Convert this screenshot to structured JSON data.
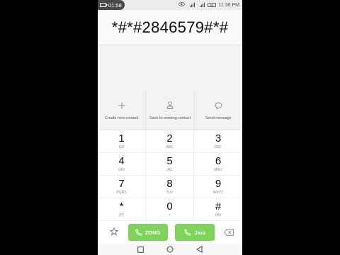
{
  "status_bar": {
    "recording_time": "01:58",
    "clock": "11:36 PM",
    "battery_level": "25",
    "signal_1_label": "4G",
    "signal_2_label": "4G"
  },
  "display": {
    "number": "*#*#2846579#*#"
  },
  "actions": [
    {
      "label": "Create new contact",
      "icon": "plus-icon"
    },
    {
      "label": "Save to existing contact",
      "icon": "person-icon"
    },
    {
      "label": "Send message",
      "icon": "message-icon"
    }
  ],
  "keypad": [
    {
      "digit": "1",
      "letters": "QD"
    },
    {
      "digit": "2",
      "letters": "ABC"
    },
    {
      "digit": "3",
      "letters": "DEF"
    },
    {
      "digit": "4",
      "letters": "GHI"
    },
    {
      "digit": "5",
      "letters": "JKL"
    },
    {
      "digit": "6",
      "letters": "MNO"
    },
    {
      "digit": "7",
      "letters": "PQRS"
    },
    {
      "digit": "8",
      "letters": "TUV"
    },
    {
      "digit": "9",
      "letters": "WXYZ"
    },
    {
      "digit": "*",
      "letters": "(P)"
    },
    {
      "digit": "0",
      "letters": "+"
    },
    {
      "digit": "#",
      "letters": "(W)"
    }
  ],
  "call_bar": {
    "call_1_label": "ZONG",
    "call_2_label": "Jazz",
    "call_color": "#7fd35a"
  }
}
